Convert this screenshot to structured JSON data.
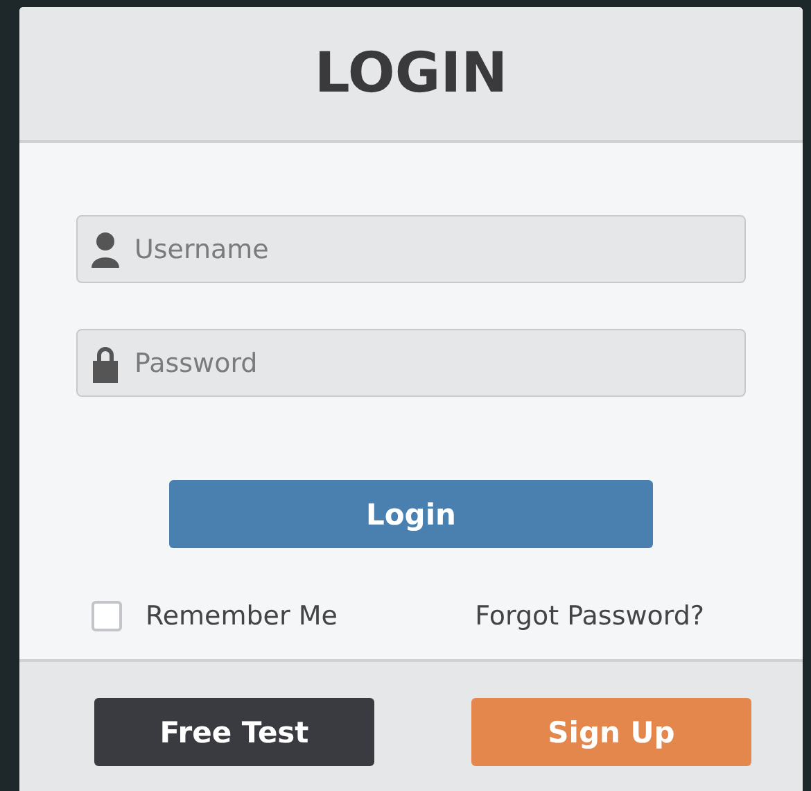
{
  "header": {
    "title": "LOGIN"
  },
  "fields": [
    {
      "kind": "user",
      "placeholder": "Username"
    },
    {
      "kind": "lock",
      "placeholder": "Password"
    }
  ],
  "login_button": "Login",
  "remember": {
    "label": "Remember Me",
    "checked": false
  },
  "forgot_link": "Forgot Password?",
  "footer_buttons": [
    {
      "kind": "dark",
      "label": "Free Test"
    },
    {
      "kind": "accent",
      "label": "Sign Up"
    }
  ]
}
